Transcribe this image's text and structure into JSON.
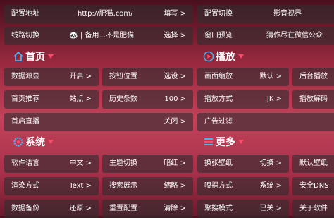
{
  "top": {
    "config_url": {
      "label": "配置地址",
      "value": "http://肥猫.com/",
      "action": "填写 >"
    },
    "config_switch": {
      "label": "配置切换",
      "value": "影音视界"
    },
    "line_switch": {
      "label": "线路切换",
      "value": "| 备用...不是肥猫",
      "action": "选择 >"
    },
    "window_preview": {
      "label": "窗口预览",
      "value": "猜作尽在微信公众"
    }
  },
  "sections": {
    "home": "首页",
    "play": "播放",
    "system": "系统",
    "more": "更多"
  },
  "home": [
    {
      "label": "数据源显",
      "value": "开启 >"
    },
    {
      "label": "按钮位置",
      "value": "选设 >"
    },
    {
      "label": "首页推荐",
      "value": "站点 >"
    },
    {
      "label": "历史条数",
      "value": "100 >"
    },
    {
      "label": "首启直播",
      "value": "关闭 >"
    }
  ],
  "play": [
    {
      "label": "画面缩放",
      "value": "默认 >"
    },
    {
      "label": "后台播放",
      "value": ""
    },
    {
      "label": "播放方式",
      "value": "IJK >"
    },
    {
      "label": "播放解码",
      "value": ""
    },
    {
      "label": "广告过滤",
      "value": ""
    }
  ],
  "system": [
    {
      "label": "软件语言",
      "value": "中文 >"
    },
    {
      "label": "主题切换",
      "value": "暗红 >"
    },
    {
      "label": "渲染方式",
      "value": "Text >"
    },
    {
      "label": "搜索展示",
      "value": "缩略 >"
    },
    {
      "label": "数据备份",
      "value": "还原 >"
    },
    {
      "label": "重置配置",
      "value": "清除 >"
    }
  ],
  "more": [
    {
      "label": "换张壁纸",
      "value": "切换 >"
    },
    {
      "label": "默认壁纸",
      "value": ""
    },
    {
      "label": "嗅探方式",
      "value": "系统 >"
    },
    {
      "label": "安全DNS",
      "value": ""
    },
    {
      "label": "聚搜模式",
      "value": "已关 >"
    },
    {
      "label": "关于软件",
      "value": ""
    }
  ],
  "colors": {
    "accent": "#ff4a6a",
    "icon_blue": "#49b6f0"
  }
}
